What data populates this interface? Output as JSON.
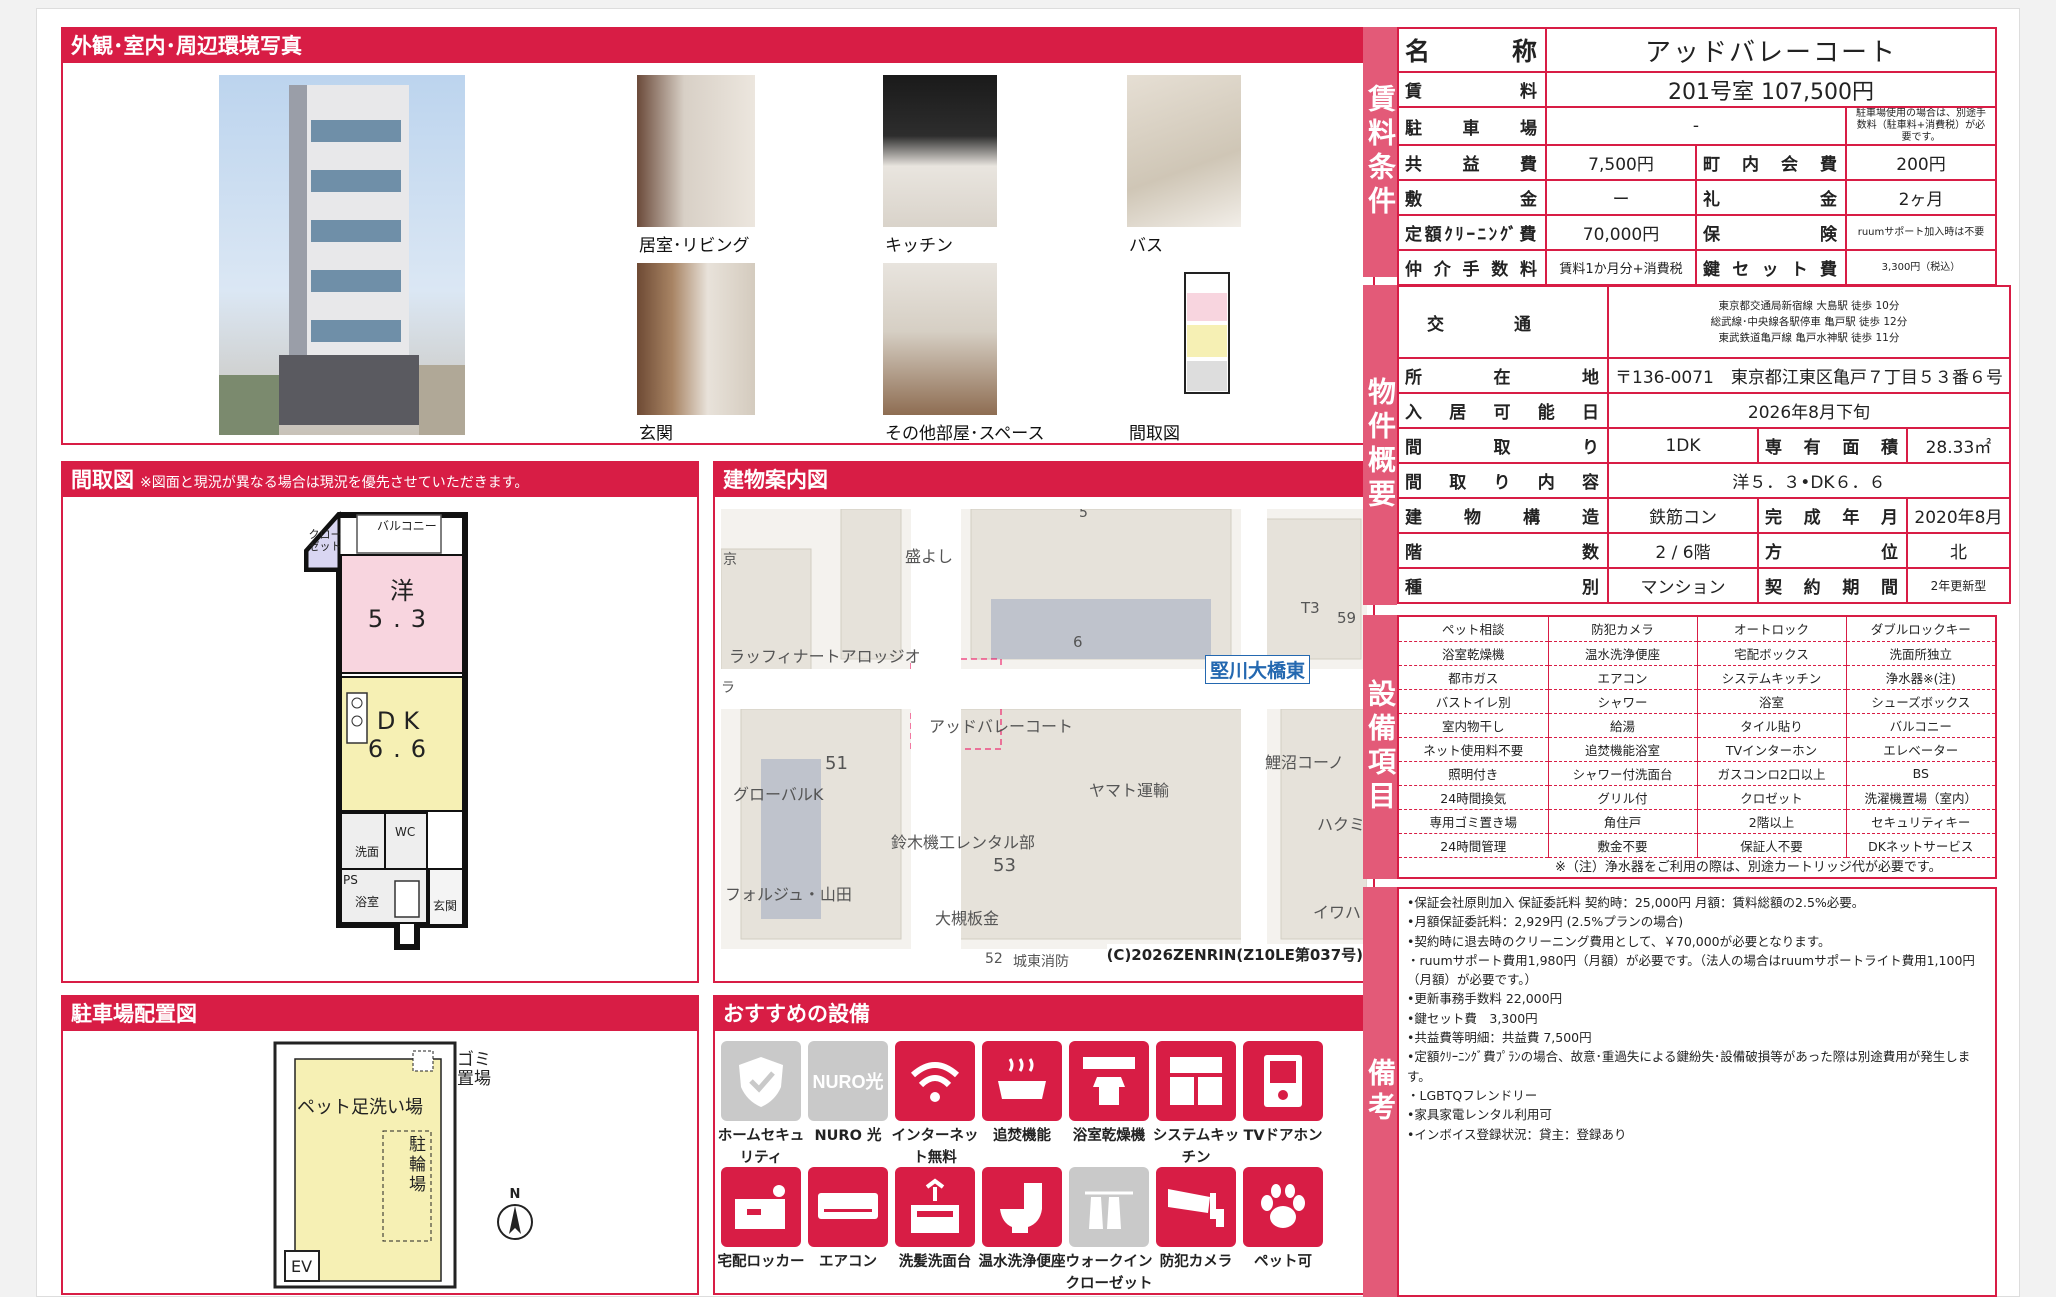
{
  "photos_panel": {
    "title": "外観･室内･周辺環境写真",
    "captions": [
      "居室･リビング",
      "キッチン",
      "バス",
      "玄関",
      "その他部屋･スペース",
      "間取図"
    ]
  },
  "floor_panel": {
    "title": "間取図",
    "note": "※図面と現況が異なる場合は現況を優先させていただきます。",
    "rooms": {
      "closet": "クロー ゼット",
      "balcony": "バルコニー",
      "western": "洋",
      "western_size": "5.3",
      "dk": "DK",
      "dk_size": "6.6",
      "wc": "WC",
      "washroom": "洗面",
      "ps": "PS",
      "bath": "浴室",
      "entrance": "玄関"
    }
  },
  "map_panel": {
    "title": "建物案内図",
    "labels": [
      "5",
      "盛よし",
      "京",
      "6",
      "T3",
      "59",
      "ラッフィナートアロッジオ",
      "堅川大橋東",
      "ラ",
      "アッドバレーコート",
      "51",
      "グローバルK",
      "ヤマト運輸",
      "鯉沼コーノ",
      "ハクミ",
      "鈴木機工レンタル部",
      "53",
      "フォルジュ・山田",
      "大槻板金",
      "イワハ",
      "52",
      "城東消防"
    ],
    "copyright": "(C)2026ZENRIN(Z10LE第037号)"
  },
  "parking_panel": {
    "title": "駐車場配置図",
    "labels": {
      "pet_wash": "ペット足洗い場",
      "garbage": "ゴミ置場",
      "bike": "駐輪場",
      "ev": "EV",
      "north": "N"
    }
  },
  "equipment_panel": {
    "title": "おすすめの設備",
    "items": [
      {
        "label": "ホームセキュリティ",
        "icon": "shield-icon",
        "active": false
      },
      {
        "label": "NURO 光",
        "icon": "nuro-icon",
        "active": false
      },
      {
        "label": "インターネット無料",
        "icon": "wifi-icon",
        "active": true
      },
      {
        "label": "追焚機能",
        "icon": "bathtub-icon",
        "active": true
      },
      {
        "label": "浴室乾燥機",
        "icon": "bath-dryer-icon",
        "active": true
      },
      {
        "label": "システムキッチン",
        "icon": "kitchen-icon",
        "active": true
      },
      {
        "label": "TVドアホン",
        "icon": "intercom-icon",
        "active": true
      },
      {
        "label": "宅配ロッカー",
        "icon": "locker-icon",
        "active": true
      },
      {
        "label": "エアコン",
        "icon": "aircon-icon",
        "active": true
      },
      {
        "label": "洗髪洗面台",
        "icon": "washbasin-icon",
        "active": true
      },
      {
        "label": "温水洗浄便座",
        "icon": "toilet-icon",
        "active": true
      },
      {
        "label": "ウォークインクローゼット",
        "icon": "closet-icon",
        "active": false
      },
      {
        "label": "防犯カメラ",
        "icon": "camera-icon",
        "active": true
      },
      {
        "label": "ペット可",
        "icon": "paw-icon",
        "active": true
      }
    ]
  },
  "rent_table": {
    "side_label": "賃料条件",
    "name_label": "名称",
    "name": "アッドバレーコート",
    "rent_label": "賃料",
    "rent": "201号室 107,500円",
    "parking_label": "駐車場",
    "parking": "-",
    "parking_note": "駐車場使用の場合は、別途手数料（駐車料+消費税）が必要です。",
    "common_label": "共益費",
    "common": "7,500円",
    "town_label": "町内会費",
    "town": "200円",
    "deposit_label": "敷金",
    "deposit": "ー",
    "key_money_label": "礼金",
    "key_money": "2ヶ月",
    "cleaning_label": "定額ｸﾘｰﾆﾝｸﾞ費",
    "cleaning": "70,000円",
    "insurance_label": "保険",
    "insurance": "ruumサポート加入時は不要",
    "brokerage_label": "仲介手数料",
    "brokerage": "賃料1か月分+消費税",
    "key_change_label": "鍵セット費",
    "key_change": "3,300円（税込）"
  },
  "property_table": {
    "side_label": "物件概要",
    "transport_label": "交通",
    "transport": [
      "東京都交通局新宿線 大島駅 徒歩 10分",
      "総武線･中央線各駅停車 亀戸駅 徒歩 12分",
      "東武鉄道亀戸線 亀戸水神駅 徒歩 11分"
    ],
    "address_label": "所在地",
    "address": "〒136-0071　東京都江東区亀戸７丁目５３番６号",
    "move_in_label": "入居可能日",
    "move_in": "2026年8月下旬",
    "layout_label": "間取り",
    "layout": "1DK",
    "area_label": "専有面積",
    "area": "28.33㎡",
    "layout_detail_label": "間取り内容",
    "layout_detail": "洋５．３•DK６．６",
    "structure_label": "建物構造",
    "structure": "鉄筋コン",
    "built_label": "完成年月",
    "built": "2020年8月",
    "floor_label": "階数",
    "floor": "2 / 6階",
    "direction_label": "方位",
    "direction": "北",
    "type_label": "種別",
    "type": "マンション",
    "contract_label": "契約期間",
    "contract": "2年更新型"
  },
  "facilities": {
    "side_label": "設備項目",
    "rows": [
      [
        "ペット相談",
        "防犯カメラ",
        "オートロック",
        "ダブルロックキー"
      ],
      [
        "浴室乾燥機",
        "温水洗浄便座",
        "宅配ボックス",
        "洗面所独立"
      ],
      [
        "都市ガス",
        "エアコン",
        "システムキッチン",
        "浄水器※(注)"
      ],
      [
        "バストイレ別",
        "シャワー",
        "浴室",
        "シューズボックス"
      ],
      [
        "室内物干し",
        "給湯",
        "タイル貼り",
        "バルコニー"
      ],
      [
        "ネット使用料不要",
        "追焚機能浴室",
        "TVインターホン",
        "エレベーター"
      ],
      [
        "照明付き",
        "シャワー付洗面台",
        "ガスコンロ2口以上",
        "BS"
      ],
      [
        "24時間換気",
        "グリル付",
        "クロゼット",
        "洗濯機置場（室内）"
      ],
      [
        "専用ゴミ置き場",
        "角住戸",
        "2階以上",
        "セキュリティキー"
      ],
      [
        "24時間管理",
        "敷金不要",
        "保証人不要",
        "DKネットサービス"
      ]
    ],
    "footnote": "※（注）浄水器をご利用の際は、別途カートリッジ代が必要です。"
  },
  "remarks": {
    "side_label": "備考",
    "lines": [
      "•保証会社原則加入 保証委託料 契約時：25,000円 月額：賃料総額の2.5%必要。",
      "•月額保証委託料：2,929円 (2.5%プランの場合)",
      "•契約時に退去時のクリーニング費用として、￥70,000が必要となります。",
      "・ruumサポート費用1,980円（月額）が必要です。（法人の場合はruumサポートライト費用1,100円（月額）が必要です。）",
      "•更新事務手数料 22,000円",
      "•鍵セット費　3,300円",
      "•共益費等明細：共益費 7,500円",
      "•定額ｸﾘｰﾆﾝｸﾞ費ﾌﾟﾗﾝの場合、故意･重過失による鍵紛失･設備破損等があった際は別途費用が発生します。",
      "・LGBTQフレンドリー",
      "•家具家電レンタル利用可",
      "•インボイス登録状況：貸主：登録あり"
    ]
  },
  "colors": {
    "accent": "#d81d45",
    "side": "#e35a78",
    "inactive": "#c9c9c9"
  }
}
